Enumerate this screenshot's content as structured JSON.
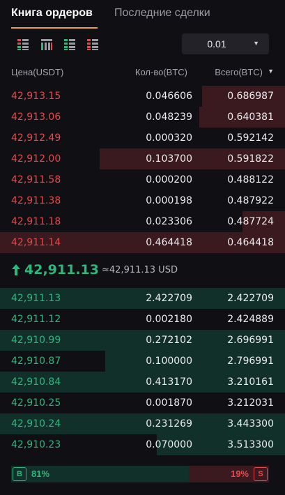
{
  "tabs": {
    "order_book": "Книга ордеров",
    "recent_trades": "Последние сделки"
  },
  "toolbar": {
    "views": [
      "orderbook-both-icon",
      "orderbook-grid-icon",
      "orderbook-bids-icon",
      "orderbook-asks-icon"
    ],
    "precision": "0.01"
  },
  "columns": {
    "price": "Цена(USDT)",
    "qty": "Кол-во(BTC)",
    "total": "Всего(BTC)"
  },
  "asks": [
    {
      "price": "42,913.15",
      "qty": "0.046606",
      "total": "0.686987",
      "depth": 0.29
    },
    {
      "price": "42,913.06",
      "qty": "0.048239",
      "total": "0.640381",
      "depth": 0.3
    },
    {
      "price": "42,912.49",
      "qty": "0.000320",
      "total": "0.592142",
      "depth": 0
    },
    {
      "price": "42,912.00",
      "qty": "0.103700",
      "total": "0.591822",
      "depth": 0.65
    },
    {
      "price": "42,911.58",
      "qty": "0.000200",
      "total": "0.488122",
      "depth": 0
    },
    {
      "price": "42,911.38",
      "qty": "0.000198",
      "total": "0.487922",
      "depth": 0
    },
    {
      "price": "42,911.18",
      "qty": "0.023306",
      "total": "0.487724",
      "depth": 0.15
    },
    {
      "price": "42,911.14",
      "qty": "0.464418",
      "total": "0.464418",
      "depth": 1.0
    }
  ],
  "mid": {
    "price": "42,911.13",
    "usd": "≈42,911.13 USD"
  },
  "bids": [
    {
      "price": "42,911.13",
      "qty": "2.422709",
      "total": "2.422709",
      "depth": 1.0
    },
    {
      "price": "42,911.12",
      "qty": "0.002180",
      "total": "2.424889",
      "depth": 0
    },
    {
      "price": "42,910.99",
      "qty": "0.272102",
      "total": "2.696991",
      "depth": 1.0
    },
    {
      "price": "42,910.87",
      "qty": "0.100000",
      "total": "2.796991",
      "depth": 0.63
    },
    {
      "price": "42,910.84",
      "qty": "0.413170",
      "total": "3.210161",
      "depth": 1.0
    },
    {
      "price": "42,910.25",
      "qty": "0.001870",
      "total": "3.212031",
      "depth": 0
    },
    {
      "price": "42,910.24",
      "qty": "0.231269",
      "total": "3.443300",
      "depth": 1.0
    },
    {
      "price": "42,910.23",
      "qty": "0.070000",
      "total": "3.513300",
      "depth": 0.45
    }
  ],
  "ratio": {
    "buy_label": "B",
    "buy_pct": "81%",
    "buy_value": 0.81,
    "sell_label": "S",
    "sell_pct": "19%",
    "sell_value": 0.19
  },
  "colors": {
    "ask": "#e5484d",
    "bid": "#2eb67d",
    "accent": "#e8a33d"
  }
}
